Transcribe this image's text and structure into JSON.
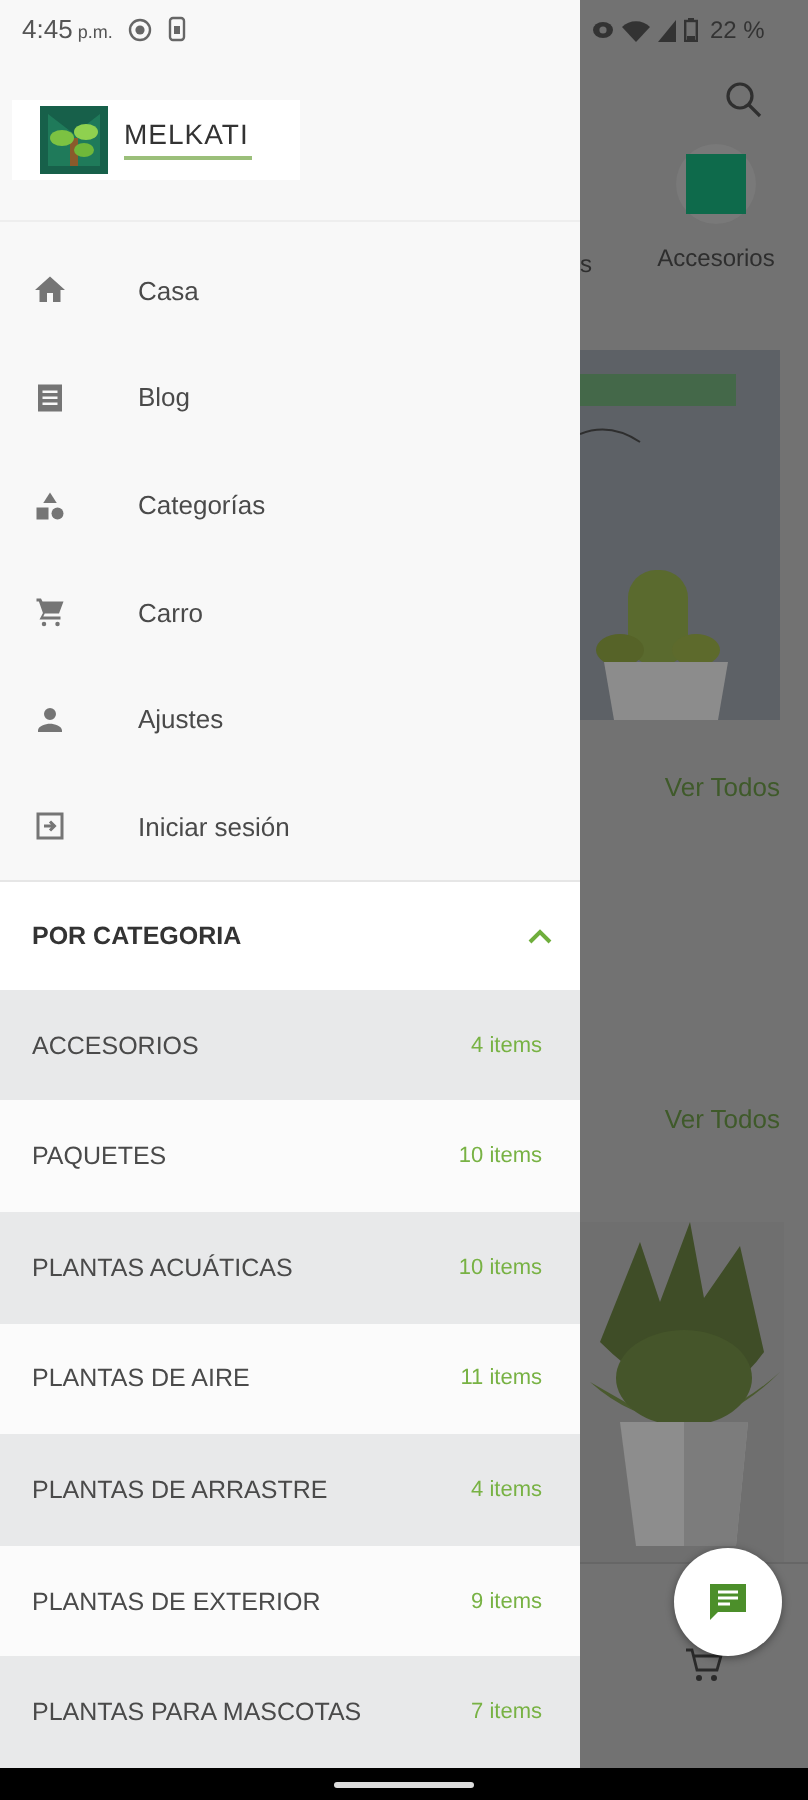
{
  "status_bar": {
    "time": "4:45",
    "time_suffix": "p.m.",
    "battery": "22 %"
  },
  "drawer": {
    "brand": "MELKATI",
    "menu": [
      {
        "kind": "home",
        "label": "Casa"
      },
      {
        "kind": "blog",
        "label": "Blog"
      },
      {
        "kind": "categories",
        "label": "Categorías"
      },
      {
        "kind": "cart",
        "label": "Carro"
      },
      {
        "kind": "person",
        "label": "Ajustes"
      },
      {
        "kind": "login",
        "label": "Iniciar sesión"
      }
    ],
    "section": {
      "title": "POR CATEGORIA",
      "expanded": true
    },
    "categories": [
      {
        "name": "ACCESORIOS",
        "count": "4 items"
      },
      {
        "name": "PAQUETES",
        "count": "10 items"
      },
      {
        "name": "PLANTAS ACUÁTICAS",
        "count": "10 items"
      },
      {
        "name": "PLANTAS DE AIRE",
        "count": "11 items"
      },
      {
        "name": "PLANTAS DE ARRASTRE",
        "count": "4 items"
      },
      {
        "name": "PLANTAS DE EXTERIOR",
        "count": "9 items"
      },
      {
        "name": "PLANTAS PARA MASCOTAS",
        "count": "7 items"
      }
    ]
  },
  "background": {
    "categories": [
      {
        "label": "s"
      },
      {
        "label": "Accesorios"
      }
    ],
    "see_all": [
      "Ver Todos",
      "Ver Todos"
    ]
  }
}
